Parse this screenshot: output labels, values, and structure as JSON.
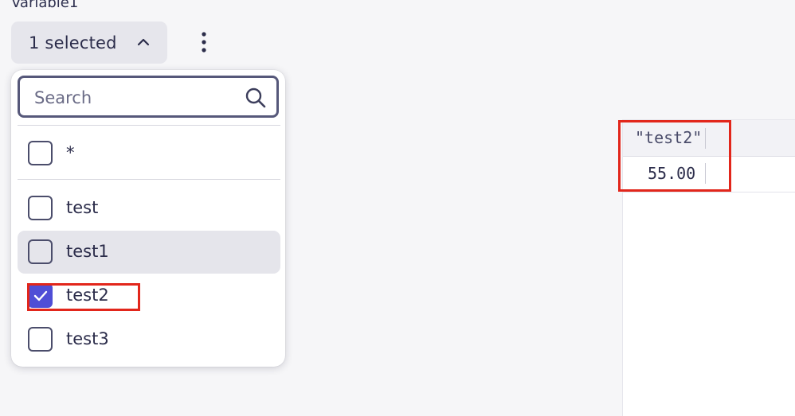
{
  "variable": {
    "label": "Variable1",
    "button_label": "1 selected"
  },
  "search": {
    "placeholder": "Search",
    "value": ""
  },
  "options": [
    {
      "label": "*",
      "checked": false
    },
    {
      "label": "test",
      "checked": false
    },
    {
      "label": "test1",
      "checked": false,
      "hovered": true
    },
    {
      "label": "test2",
      "checked": true
    },
    {
      "label": "test3",
      "checked": false
    }
  ],
  "table": {
    "columns": [
      "\"test2\""
    ],
    "rows": [
      [
        "55.00"
      ]
    ]
  },
  "colors": {
    "accent": "#4f4ed6",
    "highlight": "#e2261b"
  },
  "icons": {
    "chevron": "chevron-up-icon",
    "menu": "more-vertical-icon",
    "search": "search-icon",
    "check": "check-icon"
  }
}
